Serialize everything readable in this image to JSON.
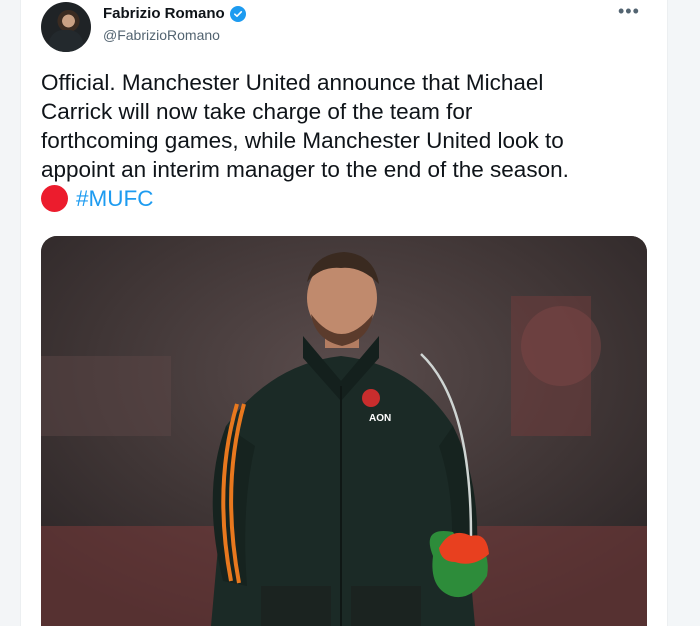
{
  "tweet": {
    "display_name": "Fabrizio Romano",
    "handle": "@FabrizioRomano",
    "more_icon": "ellipsis-icon",
    "verified_icon": "verified-badge-icon",
    "text_lines": [
      "Official. Manchester United announce that Michael",
      "Carrick will now take charge of the team for",
      "forthcoming games, while Manchester United look to",
      "appoint an interim manager to the end of the season."
    ],
    "emoji": "red-circle-icon",
    "hashtag": "#MUFC",
    "media_alt": "photo",
    "jacket_sponsor": "AON"
  },
  "colors": {
    "accent": "#1d9bf0",
    "text": "#0f1419",
    "secondary": "#536471",
    "red_circle": "#ec1c2d"
  }
}
